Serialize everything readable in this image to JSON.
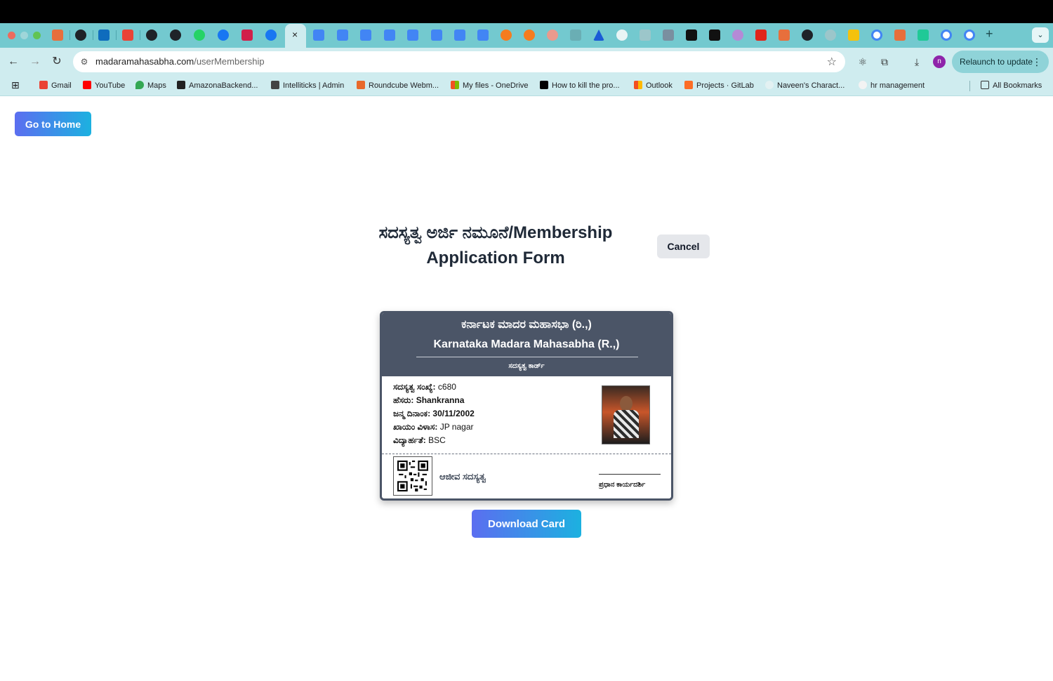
{
  "browser": {
    "active_tab_close": "×",
    "new_tab": "+",
    "tab_search": "⌄",
    "address": {
      "domain": "madaramahasabha.com",
      "path": "/userMembership"
    },
    "profile_initial": "n",
    "relaunch_label": "Relaunch to update",
    "bookmarks": [
      "Gmail",
      "YouTube",
      "Maps",
      "AmazonaBackend...",
      "Intelliticks | Admin",
      "Roundcube Webm...",
      "My files - OneDrive",
      "How to kill the pro...",
      "Outlook",
      "Projects · GitLab",
      "Naveen's Charact...",
      "hr management"
    ],
    "all_bookmarks": "All Bookmarks"
  },
  "page": {
    "home_button": "Go to Home",
    "title_line1": "ಸದಸ್ಯತ್ವ ಅರ್ಜಿ ನಮೂನೆ/Membership",
    "title_line2": "Application Form",
    "cancel_button": "Cancel",
    "download_button": "Download Card"
  },
  "card": {
    "org_kannada": "ಕರ್ನಾಟಕ ಮಾದರ ಮಹಾಸಭಾ (ರಿ.,)",
    "org_english": "Karnataka Madara Mahasabha (R.,)",
    "card_type": "ಸದಸ್ಯತ್ವ ಕಾರ್ಡ್",
    "fields": [
      {
        "label": "ಸದಸ್ಯತ್ವ ಸಂಖ್ಯೆ:",
        "value": "c680"
      },
      {
        "label": "ಹೆಸರು:",
        "value": "Shankranna"
      },
      {
        "label": "ಜನ್ಮ ದಿನಾಂಕ:",
        "value": "30/11/2002"
      },
      {
        "label": "ಖಾಯಂ ವಿಳಾಸ:",
        "value": "JP nagar"
      },
      {
        "label": "ವಿದ್ಯಾರ್ಹತೆ:",
        "value": "BSC"
      }
    ],
    "membership_type": "ಆಜೀವ ಸದಸ್ಯತ್ವ",
    "signature_label": "ಪ್ರಧಾನ ಕಾರ್ಯದರ್ಶಿ"
  },
  "colors": {
    "tabstrip": "#73c9cf",
    "toolbar": "#cfecef",
    "card_header": "#4b5567",
    "button_gradient_start": "#5b6ef0",
    "button_gradient_end": "#1cb1e0"
  }
}
